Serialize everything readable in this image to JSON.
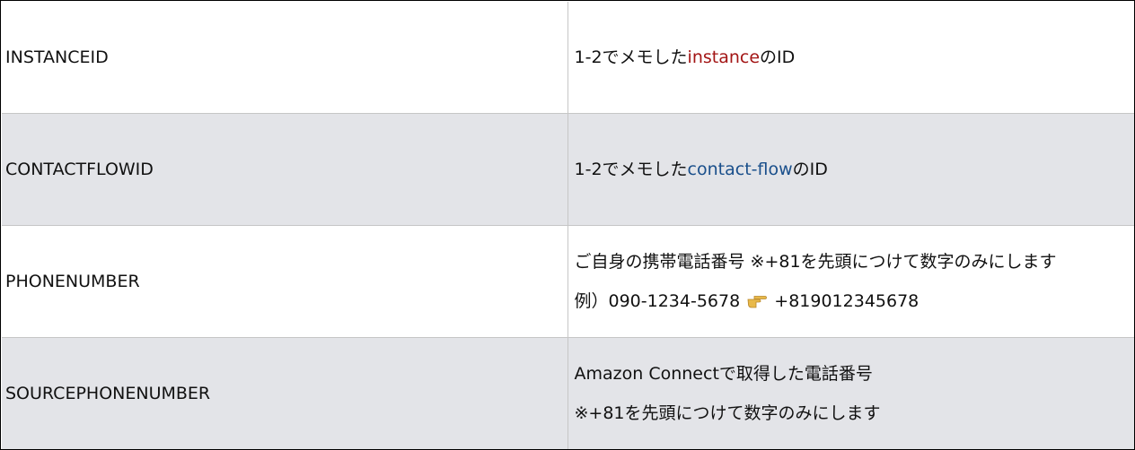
{
  "rows": [
    {
      "key": "INSTANCEID",
      "value": {
        "before": "1-2でメモした",
        "highlight": "instance",
        "highlight_color": "#a31515",
        "after": "のID"
      }
    },
    {
      "key": "CONTACTFLOWID",
      "value": {
        "before": "1-2でメモした",
        "highlight": "contact-flow",
        "highlight_color": "#1a4f8b",
        "after": "のID"
      }
    },
    {
      "key": "PHONENUMBER",
      "line1": "ご自身の携帯電話番号 ※+81を先頭につけて数字のみにします",
      "line2_before": "例）090-1234-5678",
      "line2_icon": "pointing-hand-icon",
      "line2_after": "+819012345678"
    },
    {
      "key": "SOURCEPHONENUMBER",
      "line1": "Amazon Connectで取得した電話番号",
      "line2": "※+81を先頭につけて数字のみにします"
    }
  ],
  "colors": {
    "shaded_row": "#e3e4e8",
    "border": "#c6c6c6",
    "icon": "#e8b94a"
  }
}
